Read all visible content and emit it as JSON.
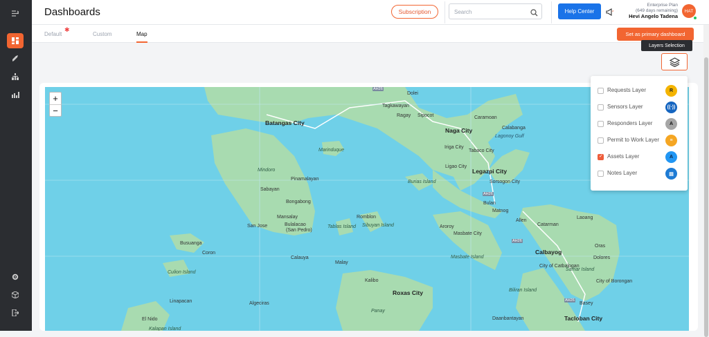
{
  "header": {
    "title": "Dashboards",
    "subscription_label": "Subscription",
    "search_placeholder": "Search",
    "help_label": "Help Center",
    "plan_name": "Enterprise Plan",
    "plan_remaining": "(649 days remaining)",
    "user_name": "Hevi Angelo Tadena",
    "avatar_initials": "HAT"
  },
  "tabs": [
    {
      "label": "Default",
      "active": false,
      "has_dot": true
    },
    {
      "label": "Custom",
      "active": false
    },
    {
      "label": "Map",
      "active": true
    }
  ],
  "primary_dashboard_label": "Set as primary dashboard",
  "layers_tooltip": "Layers Selection",
  "layers": [
    {
      "label": "Requests Layer",
      "checked": false,
      "icon": "R",
      "icon_bg": "#f4b400",
      "icon_color": "#222"
    },
    {
      "label": "Sensors Layer",
      "checked": false,
      "icon": "((·))",
      "icon_bg": "#1565c0",
      "icon_color": "#fff"
    },
    {
      "label": "Responders Layer",
      "checked": false,
      "icon": "A",
      "icon_bg": "#a6a6a6",
      "icon_color": "#111"
    },
    {
      "label": "Permit to Work Layer",
      "checked": false,
      "icon": "≡",
      "icon_bg": "#f5a623",
      "icon_color": "#fff"
    },
    {
      "label": "Assets Layer",
      "checked": true,
      "icon": "A",
      "icon_bg": "#2196f3",
      "icon_color": "#0b2545"
    },
    {
      "label": "Notes Layer",
      "checked": false,
      "icon": "▤",
      "icon_bg": "#1e7bd4",
      "icon_color": "#fff"
    }
  ],
  "map": {
    "zoom_in": "+",
    "zoom_out": "−",
    "labels": [
      {
        "text": "Batangas City",
        "cls": "city"
      },
      {
        "text": "Dolei",
        "cls": ""
      },
      {
        "text": "Tagkawayan",
        "cls": ""
      },
      {
        "text": "Ragay",
        "cls": ""
      },
      {
        "text": "Sipocot",
        "cls": ""
      },
      {
        "text": "Caramoan",
        "cls": ""
      },
      {
        "text": "Naga City",
        "cls": "city"
      },
      {
        "text": "Calabanga",
        "cls": ""
      },
      {
        "text": "Lagonoy Gulf",
        "cls": "sea"
      },
      {
        "text": "Marinduque",
        "cls": "isl"
      },
      {
        "text": "Iriga City",
        "cls": ""
      },
      {
        "text": "Tabaco City",
        "cls": ""
      },
      {
        "text": "Mindoro",
        "cls": "isl"
      },
      {
        "text": "Pinamalayan",
        "cls": ""
      },
      {
        "text": "Legazpi City",
        "cls": "city"
      },
      {
        "text": "Ligao City",
        "cls": ""
      },
      {
        "text": "Burias Island",
        "cls": "isl"
      },
      {
        "text": "Sorsogon City",
        "cls": ""
      },
      {
        "text": "Sabayan",
        "cls": ""
      },
      {
        "text": "Bongabong",
        "cls": ""
      },
      {
        "text": "Bulan",
        "cls": ""
      },
      {
        "text": "Matnog",
        "cls": ""
      },
      {
        "text": "Mansalay",
        "cls": ""
      },
      {
        "text": "Romblon",
        "cls": ""
      },
      {
        "text": "San Jose",
        "cls": ""
      },
      {
        "text": "Bulalacao",
        "cls": ""
      },
      {
        "text": "(San Pedro)",
        "cls": ""
      },
      {
        "text": "Tablas Island",
        "cls": "isl"
      },
      {
        "text": "Sibuyan Island",
        "cls": "isl"
      },
      {
        "text": "Aroroy",
        "cls": ""
      },
      {
        "text": "Masbate City",
        "cls": ""
      },
      {
        "text": "Allen",
        "cls": ""
      },
      {
        "text": "Catarman",
        "cls": ""
      },
      {
        "text": "Laoang",
        "cls": ""
      },
      {
        "text": "Busuanga",
        "cls": ""
      },
      {
        "text": "Coron",
        "cls": ""
      },
      {
        "text": "Calauya",
        "cls": ""
      },
      {
        "text": "Calbayog",
        "cls": "city"
      },
      {
        "text": "Oras",
        "cls": ""
      },
      {
        "text": "Masbate Island",
        "cls": "isl"
      },
      {
        "text": "Culion Island",
        "cls": "isl"
      },
      {
        "text": "Malay",
        "cls": ""
      },
      {
        "text": "City of Catbalogan",
        "cls": ""
      },
      {
        "text": "Samar Island",
        "cls": "isl"
      },
      {
        "text": "Dolores",
        "cls": ""
      },
      {
        "text": "Kalibo",
        "cls": ""
      },
      {
        "text": "Roxas City",
        "cls": "city"
      },
      {
        "text": "Biliran Island",
        "cls": "isl"
      },
      {
        "text": "City of Borongan",
        "cls": ""
      },
      {
        "text": "Linapacan",
        "cls": ""
      },
      {
        "text": "Algeciras",
        "cls": ""
      },
      {
        "text": "Basey",
        "cls": ""
      },
      {
        "text": "Panay",
        "cls": "isl"
      },
      {
        "text": "El Nido",
        "cls": ""
      },
      {
        "text": "Tacloban City",
        "cls": "city"
      },
      {
        "text": "Daanbantayan",
        "cls": ""
      },
      {
        "text": "Kalapan Island",
        "cls": "isl"
      },
      {
        "text": "AH26",
        "cls": "road"
      },
      {
        "text": "AH26",
        "cls": "road"
      },
      {
        "text": "AH26",
        "cls": "road"
      },
      {
        "text": "AH26",
        "cls": "road"
      }
    ]
  }
}
